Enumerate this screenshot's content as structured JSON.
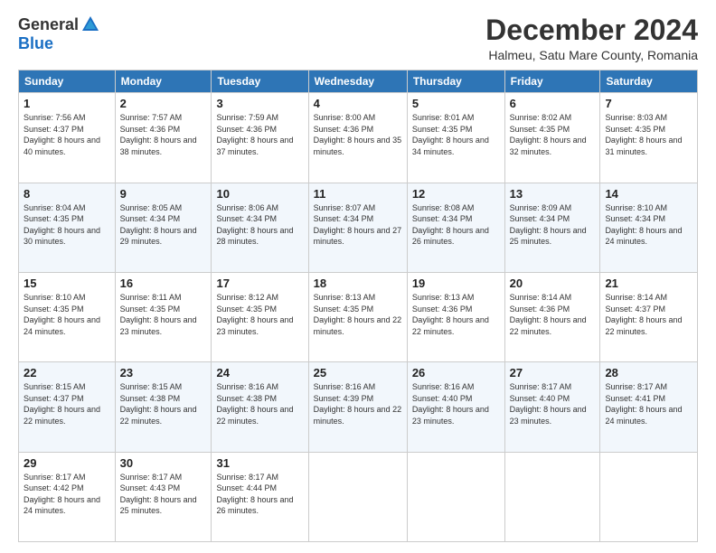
{
  "logo": {
    "general": "General",
    "blue": "Blue"
  },
  "title": "December 2024",
  "location": "Halmeu, Satu Mare County, Romania",
  "days_of_week": [
    "Sunday",
    "Monday",
    "Tuesday",
    "Wednesday",
    "Thursday",
    "Friday",
    "Saturday"
  ],
  "weeks": [
    [
      {
        "day": "1",
        "sunrise": "7:56 AM",
        "sunset": "4:37 PM",
        "daylight": "8 hours and 40 minutes."
      },
      {
        "day": "2",
        "sunrise": "7:57 AM",
        "sunset": "4:36 PM",
        "daylight": "8 hours and 38 minutes."
      },
      {
        "day": "3",
        "sunrise": "7:59 AM",
        "sunset": "4:36 PM",
        "daylight": "8 hours and 37 minutes."
      },
      {
        "day": "4",
        "sunrise": "8:00 AM",
        "sunset": "4:36 PM",
        "daylight": "8 hours and 35 minutes."
      },
      {
        "day": "5",
        "sunrise": "8:01 AM",
        "sunset": "4:35 PM",
        "daylight": "8 hours and 34 minutes."
      },
      {
        "day": "6",
        "sunrise": "8:02 AM",
        "sunset": "4:35 PM",
        "daylight": "8 hours and 32 minutes."
      },
      {
        "day": "7",
        "sunrise": "8:03 AM",
        "sunset": "4:35 PM",
        "daylight": "8 hours and 31 minutes."
      }
    ],
    [
      {
        "day": "8",
        "sunrise": "8:04 AM",
        "sunset": "4:35 PM",
        "daylight": "8 hours and 30 minutes."
      },
      {
        "day": "9",
        "sunrise": "8:05 AM",
        "sunset": "4:34 PM",
        "daylight": "8 hours and 29 minutes."
      },
      {
        "day": "10",
        "sunrise": "8:06 AM",
        "sunset": "4:34 PM",
        "daylight": "8 hours and 28 minutes."
      },
      {
        "day": "11",
        "sunrise": "8:07 AM",
        "sunset": "4:34 PM",
        "daylight": "8 hours and 27 minutes."
      },
      {
        "day": "12",
        "sunrise": "8:08 AM",
        "sunset": "4:34 PM",
        "daylight": "8 hours and 26 minutes."
      },
      {
        "day": "13",
        "sunrise": "8:09 AM",
        "sunset": "4:34 PM",
        "daylight": "8 hours and 25 minutes."
      },
      {
        "day": "14",
        "sunrise": "8:10 AM",
        "sunset": "4:34 PM",
        "daylight": "8 hours and 24 minutes."
      }
    ],
    [
      {
        "day": "15",
        "sunrise": "8:10 AM",
        "sunset": "4:35 PM",
        "daylight": "8 hours and 24 minutes."
      },
      {
        "day": "16",
        "sunrise": "8:11 AM",
        "sunset": "4:35 PM",
        "daylight": "8 hours and 23 minutes."
      },
      {
        "day": "17",
        "sunrise": "8:12 AM",
        "sunset": "4:35 PM",
        "daylight": "8 hours and 23 minutes."
      },
      {
        "day": "18",
        "sunrise": "8:13 AM",
        "sunset": "4:35 PM",
        "daylight": "8 hours and 22 minutes."
      },
      {
        "day": "19",
        "sunrise": "8:13 AM",
        "sunset": "4:36 PM",
        "daylight": "8 hours and 22 minutes."
      },
      {
        "day": "20",
        "sunrise": "8:14 AM",
        "sunset": "4:36 PM",
        "daylight": "8 hours and 22 minutes."
      },
      {
        "day": "21",
        "sunrise": "8:14 AM",
        "sunset": "4:37 PM",
        "daylight": "8 hours and 22 minutes."
      }
    ],
    [
      {
        "day": "22",
        "sunrise": "8:15 AM",
        "sunset": "4:37 PM",
        "daylight": "8 hours and 22 minutes."
      },
      {
        "day": "23",
        "sunrise": "8:15 AM",
        "sunset": "4:38 PM",
        "daylight": "8 hours and 22 minutes."
      },
      {
        "day": "24",
        "sunrise": "8:16 AM",
        "sunset": "4:38 PM",
        "daylight": "8 hours and 22 minutes."
      },
      {
        "day": "25",
        "sunrise": "8:16 AM",
        "sunset": "4:39 PM",
        "daylight": "8 hours and 22 minutes."
      },
      {
        "day": "26",
        "sunrise": "8:16 AM",
        "sunset": "4:40 PM",
        "daylight": "8 hours and 23 minutes."
      },
      {
        "day": "27",
        "sunrise": "8:17 AM",
        "sunset": "4:40 PM",
        "daylight": "8 hours and 23 minutes."
      },
      {
        "day": "28",
        "sunrise": "8:17 AM",
        "sunset": "4:41 PM",
        "daylight": "8 hours and 24 minutes."
      }
    ],
    [
      {
        "day": "29",
        "sunrise": "8:17 AM",
        "sunset": "4:42 PM",
        "daylight": "8 hours and 24 minutes."
      },
      {
        "day": "30",
        "sunrise": "8:17 AM",
        "sunset": "4:43 PM",
        "daylight": "8 hours and 25 minutes."
      },
      {
        "day": "31",
        "sunrise": "8:17 AM",
        "sunset": "4:44 PM",
        "daylight": "8 hours and 26 minutes."
      },
      null,
      null,
      null,
      null
    ]
  ]
}
